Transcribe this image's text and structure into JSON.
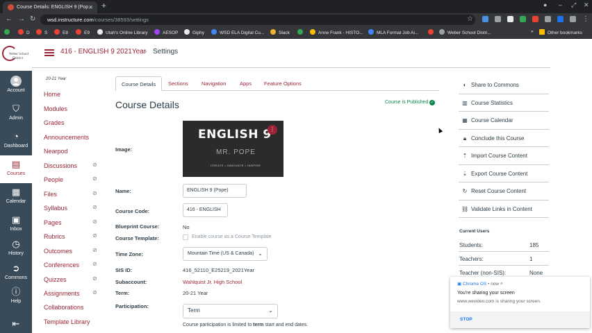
{
  "browser": {
    "tab_title": "Course Details: ENGLISH 9 (Pop…",
    "url_host": "wsd.instructure.com",
    "url_path": "/courses/38593/settings",
    "bookmarks": [
      "D",
      "S",
      "E8",
      "E9",
      "Utah's Online Library",
      "AESOP",
      "Giphy",
      "WSD ELA Digital Cu...",
      "Slack",
      "Anne Frank - HISTO...",
      "MLA Format Job Ai...",
      "Weber School Distri..."
    ],
    "other_bookmarks": "Other bookmarks"
  },
  "global_nav": {
    "logo_line1": "Weber School",
    "logo_line2": "District",
    "items": [
      {
        "label": "Account",
        "icon": "user-icon"
      },
      {
        "label": "Admin",
        "icon": "shield-icon"
      },
      {
        "label": "Dashboard",
        "icon": "dashboard-icon"
      },
      {
        "label": "Courses",
        "icon": "book-icon"
      },
      {
        "label": "Calendar",
        "icon": "calendar-icon"
      },
      {
        "label": "Inbox",
        "icon": "inbox-icon"
      },
      {
        "label": "History",
        "icon": "history-icon"
      },
      {
        "label": "Commons",
        "icon": "commons-icon"
      },
      {
        "label": "Help",
        "icon": "help-icon"
      }
    ]
  },
  "breadcrumb": {
    "course": "416 - ENGLISH 9 2021Year",
    "page": "Settings"
  },
  "course_nav": {
    "term": "20-21 Year",
    "items": [
      "Home",
      "Modules",
      "Grades",
      "Announcements",
      "Nearpod",
      "Discussions",
      "People",
      "Files",
      "Syllabus",
      "Pages",
      "Rubrics",
      "Outcomes",
      "Conferences",
      "Quizzes",
      "Assignments",
      "Collaborations",
      "Template Library"
    ]
  },
  "tabs": [
    "Course Details",
    "Sections",
    "Navigation",
    "Apps",
    "Feature Options"
  ],
  "details": {
    "heading": "Course Details",
    "published": "Course is Published",
    "image_label": "Image:",
    "image_title": "ENGLISH 9",
    "image_sub": "MR. POPE",
    "image_tagline": "CREATE • INNOVATE • INSPIRE",
    "name_label": "Name:",
    "name_value": "ENGLISH 9 (Pope)",
    "code_label": "Course Code:",
    "code_value": "416 - ENGLISH",
    "blueprint_label": "Blueprint Course:",
    "blueprint_value": "No",
    "template_label": "Course Template:",
    "template_checkbox": "Enable course as a Course Template",
    "tz_label": "Time Zone:",
    "tz_value": "Mountain Time (US & Canada)",
    "sis_label": "SIS ID:",
    "sis_value": "416_52110_E25219_2021Year",
    "subaccount_label": "Subaccount:",
    "subaccount_value": "Wahlquist Jr. High School",
    "term_label": "Term:",
    "term_value": "20-21 Year",
    "participation_label": "Participation:",
    "participation_value": "Term",
    "note_pre": "Course participation is limited to",
    "note_bold": "term",
    "note_post": "start and end dates."
  },
  "sidebar": {
    "actions": [
      {
        "label": "Share to Commons",
        "icon": "share-icon"
      },
      {
        "label": "Course Statistics",
        "icon": "stats-icon"
      },
      {
        "label": "Course Calendar",
        "icon": "calendar-icon"
      },
      {
        "label": "Conclude this Course",
        "icon": "lock-icon"
      },
      {
        "label": "Import Course Content",
        "icon": "upload-icon"
      },
      {
        "label": "Export Course Content",
        "icon": "download-icon"
      },
      {
        "label": "Reset Course Content",
        "icon": "reset-icon"
      },
      {
        "label": "Validate Links in Content",
        "icon": "link-icon"
      }
    ],
    "current_users_title": "Current Users",
    "users": [
      {
        "label": "Students:",
        "value": "185"
      },
      {
        "label": "Teachers:",
        "value": "1"
      },
      {
        "label": "Teacher (non-SIS):",
        "value": "None"
      }
    ]
  },
  "notification": {
    "source": "Chrome OS",
    "time": "• now ˄",
    "title": "You're sharing your screen",
    "body": "www.wevideo.com is sharing your screen.",
    "action": "STOP"
  },
  "colors": {
    "brand": "#9b2335",
    "nav_bg": "#394b58",
    "success": "#0b874b"
  }
}
